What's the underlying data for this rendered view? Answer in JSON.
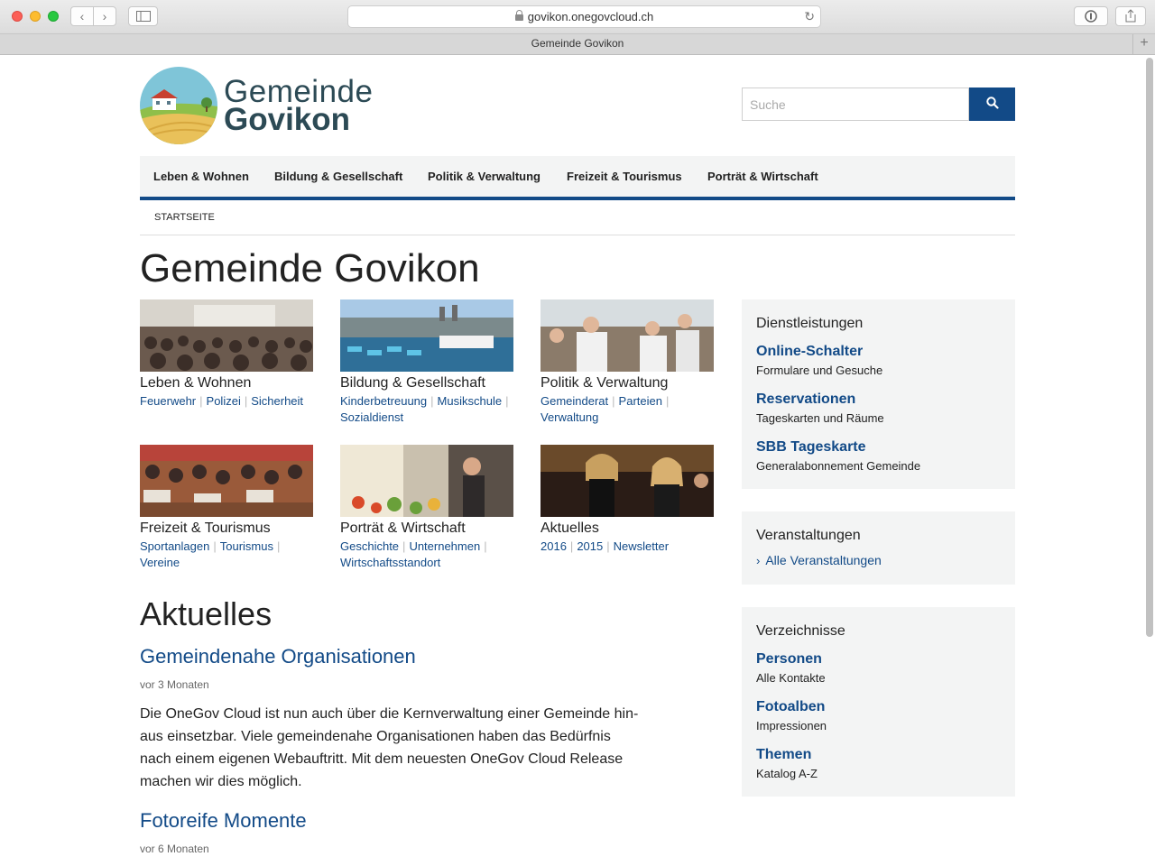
{
  "browser": {
    "url": "govikon.onegovcloud.ch",
    "tab_title": "Gemeinde Govikon"
  },
  "site": {
    "brand_line1": "Gemeinde",
    "brand_line2": "Govikon",
    "search_placeholder": "Suche"
  },
  "nav": [
    "Leben & Wohnen",
    "Bildung & Gesellschaft",
    "Politik & Verwaltung",
    "Freizeit & Tourismus",
    "Porträt & Wirtschaft"
  ],
  "breadcrumb": "STARTSEITE",
  "page_title": "Gemeinde Govikon",
  "tiles": [
    {
      "title": "Leben & Wohnen",
      "links": [
        "Feuerwehr",
        "Polizei",
        "Sicherheit"
      ]
    },
    {
      "title": "Bildung & Gesellschaft",
      "links": [
        "Kinderbetreuung",
        "Musikschule",
        "Sozialdienst"
      ]
    },
    {
      "title": "Politik & Verwaltung",
      "links": [
        "Gemeinderat",
        "Parteien",
        "Verwaltung"
      ]
    },
    {
      "title": "Freizeit & Tourismus",
      "links": [
        "Sportanlagen",
        "Tourismus",
        "Vereine"
      ]
    },
    {
      "title": "Porträt & Wirtschaft",
      "links": [
        "Geschichte",
        "Unternehmen",
        "Wirtschaftsstandort"
      ]
    },
    {
      "title": "Aktuelles",
      "links": [
        "2016",
        "2015",
        "Newsletter"
      ]
    }
  ],
  "news": {
    "heading": "Aktuelles",
    "items": [
      {
        "title": "Gemeindenahe Organisationen",
        "meta": "vor 3 Monaten",
        "body": "Die OneGov Cloud ist nun auch über die Kernverwaltung einer Gemeinde hin­aus einsetzbar. Viele gemeindenahe Organisationen haben das Bedürfnis nach einem eigenen Webauftritt. Mit dem neuesten OneGov Cloud Release machen wir dies möglich."
      },
      {
        "title": "Fotoreife Momente",
        "meta": "vor 6 Monaten"
      }
    ]
  },
  "sidebar": {
    "services": {
      "heading": "Dienstleistungen",
      "items": [
        {
          "title": "Online-Schalter",
          "sub": "Formulare und Gesuche"
        },
        {
          "title": "Reservationen",
          "sub": "Tageskarten und Räume"
        },
        {
          "title": "SBB Tageskarte",
          "sub": "Generalabonnement Gemeinde"
        }
      ]
    },
    "events": {
      "heading": "Veranstaltungen",
      "link": "Alle Veranstaltungen"
    },
    "directories": {
      "heading": "Verzeichnisse",
      "items": [
        {
          "title": "Personen",
          "sub": "Alle Kontakte"
        },
        {
          "title": "Fotoalben",
          "sub": "Impressionen"
        },
        {
          "title": "Themen",
          "sub": "Katalog A-Z"
        }
      ]
    }
  },
  "colors": {
    "accent": "#124a87",
    "panel_bg": "#f3f4f4",
    "brand_text": "#2c4a55"
  }
}
